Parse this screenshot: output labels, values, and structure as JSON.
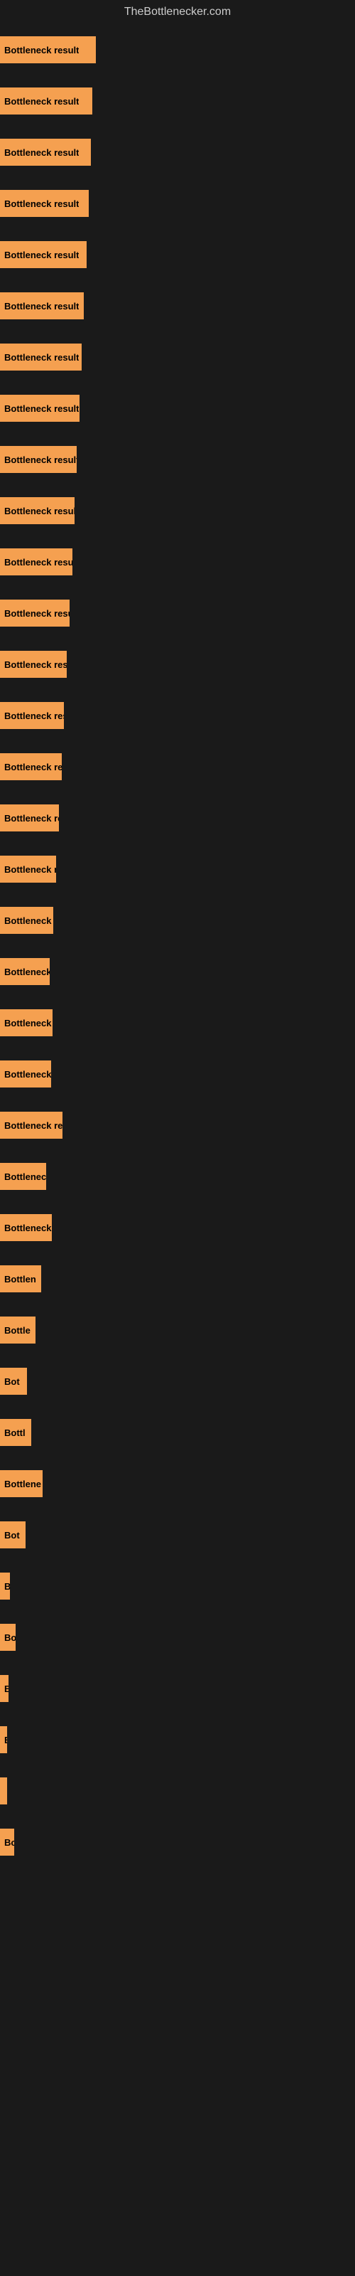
{
  "site": {
    "title": "TheBottlenecker.com"
  },
  "bars": [
    {
      "label": "Bottleneck result",
      "width": 135
    },
    {
      "label": "Bottleneck result",
      "width": 130
    },
    {
      "label": "Bottleneck result",
      "width": 128
    },
    {
      "label": "Bottleneck result",
      "width": 125
    },
    {
      "label": "Bottleneck result",
      "width": 122
    },
    {
      "label": "Bottleneck result",
      "width": 118
    },
    {
      "label": "Bottleneck result",
      "width": 115
    },
    {
      "label": "Bottleneck result",
      "width": 112
    },
    {
      "label": "Bottleneck result",
      "width": 108
    },
    {
      "label": "Bottleneck result",
      "width": 105
    },
    {
      "label": "Bottleneck result",
      "width": 102
    },
    {
      "label": "Bottleneck result",
      "width": 98
    },
    {
      "label": "Bottleneck result",
      "width": 94
    },
    {
      "label": "Bottleneck result",
      "width": 90
    },
    {
      "label": "Bottleneck result",
      "width": 87
    },
    {
      "label": "Bottleneck result",
      "width": 83
    },
    {
      "label": "Bottleneck result",
      "width": 79
    },
    {
      "label": "Bottleneck resu",
      "width": 75
    },
    {
      "label": "Bottleneck r",
      "width": 70
    },
    {
      "label": "Bottleneck resu",
      "width": 74
    },
    {
      "label": "Bottleneck re",
      "width": 72
    },
    {
      "label": "Bottleneck result",
      "width": 88
    },
    {
      "label": "Bottleneck",
      "width": 65
    },
    {
      "label": "Bottleneck resu",
      "width": 73
    },
    {
      "label": "Bottlen",
      "width": 58
    },
    {
      "label": "Bottle",
      "width": 50
    },
    {
      "label": "Bot",
      "width": 38
    },
    {
      "label": "Bottl",
      "width": 44
    },
    {
      "label": "Bottlene",
      "width": 60
    },
    {
      "label": "Bot",
      "width": 36
    },
    {
      "label": "B",
      "width": 14
    },
    {
      "label": "Bo",
      "width": 22
    },
    {
      "label": "B",
      "width": 12
    },
    {
      "label": "B",
      "width": 10
    },
    {
      "label": "",
      "width": 8
    },
    {
      "label": "Bo",
      "width": 20
    }
  ]
}
